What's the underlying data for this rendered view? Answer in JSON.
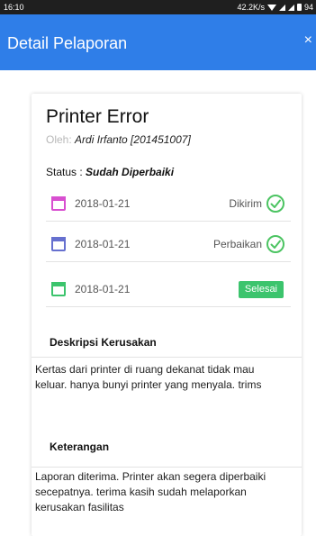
{
  "status_bar": {
    "time": "16:10",
    "network_speed": "42.2K/s",
    "battery": "94"
  },
  "app_bar": {
    "title": "Detail Pelaporan",
    "close_symbol": "×"
  },
  "report": {
    "title": "Printer Error",
    "by_label": "Oleh:",
    "reporter": "Ardi Irfanto [201451007]",
    "status_label": "Status :",
    "status_value": "Sudah Diperbaiki"
  },
  "timeline": [
    {
      "date": "2018-01-21",
      "stage": "Dikirim",
      "icon": "check-circle-icon",
      "color": "#d84fd0"
    },
    {
      "date": "2018-01-21",
      "stage": "Perbaikan",
      "icon": "check-circle-icon",
      "color": "#6670cf"
    },
    {
      "date": "2018-01-21",
      "stage": "Selesai",
      "icon": "badge",
      "color": "#3cc46d"
    }
  ],
  "colors": {
    "app_bar": "#2f7ee8",
    "check": "#4cc462",
    "badge": "#3cc46d"
  },
  "sections": {
    "damage_title": "Deskripsi Kerusakan",
    "damage_text": "Kertas dari printer di ruang dekanat tidak mau keluar. hanya bunyi printer yang menyala. trims",
    "notes_title": "Keterangan",
    "notes_text": "Laporan diterima. Printer akan segera diperbaiki secepatnya. terima kasih sudah melaporkan kerusakan fasilitas"
  }
}
